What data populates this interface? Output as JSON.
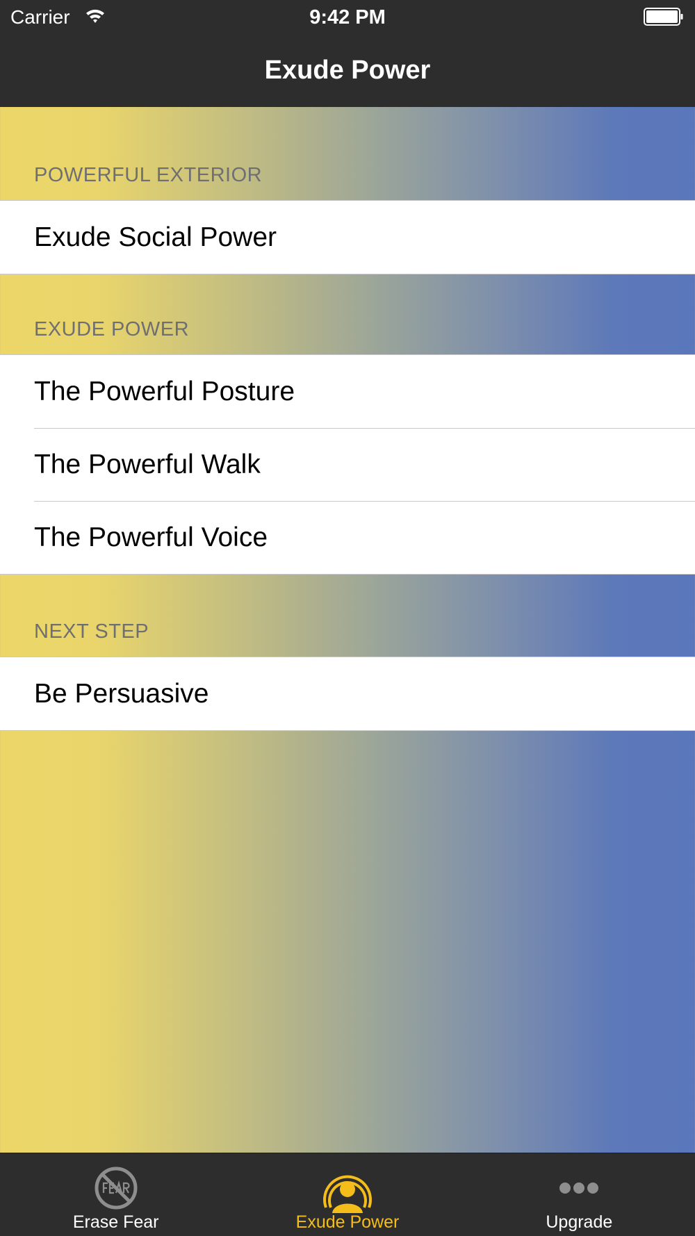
{
  "status_bar": {
    "carrier": "Carrier",
    "time": "9:42 PM"
  },
  "nav": {
    "title": "Exude Power"
  },
  "sections": [
    {
      "header": "POWERFUL EXTERIOR",
      "items": [
        "Exude Social Power"
      ]
    },
    {
      "header": "EXUDE POWER",
      "items": [
        "The Powerful Posture",
        "The Powerful Walk",
        "The Powerful Voice"
      ]
    },
    {
      "header": "NEXT STEP",
      "items": [
        "Be Persuasive"
      ]
    }
  ],
  "tabs": [
    {
      "label": "Erase Fear",
      "icon": "erase-fear-icon",
      "active": false
    },
    {
      "label": "Exude Power",
      "icon": "exude-power-icon",
      "active": true
    },
    {
      "label": "Upgrade",
      "icon": "more-icon",
      "active": false
    }
  ],
  "colors": {
    "bar_background": "#2d2d2d",
    "accent": "#f4bd1a",
    "gradient_left": "#ecd668",
    "gradient_right": "#5a77bb",
    "section_header_text": "#6f6f72"
  }
}
